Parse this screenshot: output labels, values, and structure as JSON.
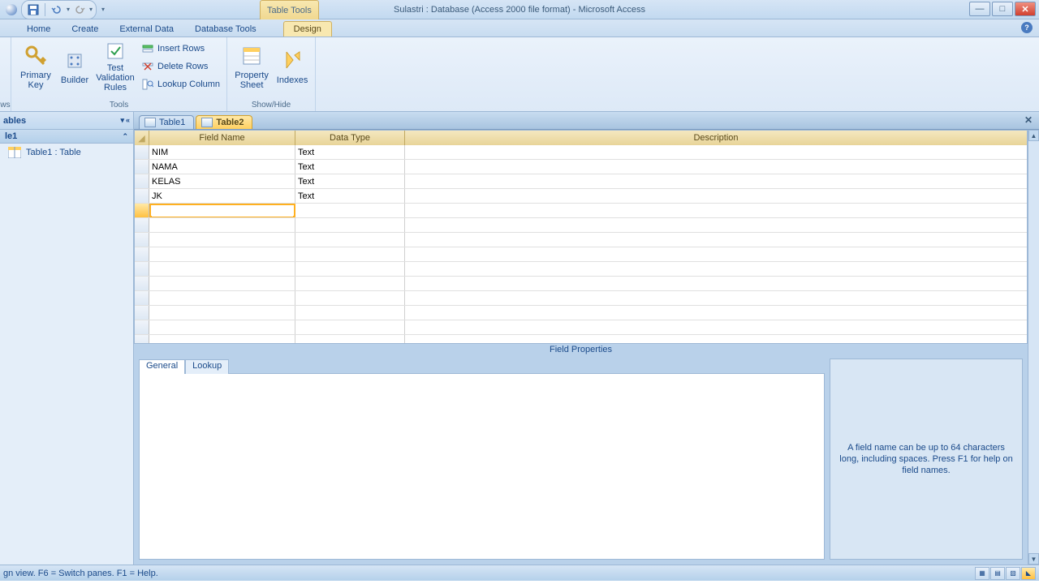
{
  "titlebar": {
    "context_tab": "Table Tools",
    "title": "Sulastri : Database (Access 2000 file format) - Microsoft Access"
  },
  "ribbon_tabs": {
    "home": "Home",
    "create": "Create",
    "external": "External Data",
    "dbtools": "Database Tools",
    "design": "Design"
  },
  "ribbon": {
    "views": "ws",
    "primary_key": "Primary Key",
    "builder": "Builder",
    "test_rules": "Test Validation Rules",
    "tools_label": "Tools",
    "insert_rows": "Insert Rows",
    "delete_rows": "Delete Rows",
    "lookup_column": "Lookup Column",
    "property_sheet": "Property Sheet",
    "indexes": "Indexes",
    "showhide_label": "Show/Hide"
  },
  "navpane": {
    "header": "ables",
    "group": "le1",
    "item1": "Table1 : Table"
  },
  "tabs": {
    "t1": "Table1",
    "t2": "Table2"
  },
  "grid": {
    "col_field": "Field Name",
    "col_type": "Data Type",
    "col_desc": "Description",
    "rows": [
      {
        "name": "NIM",
        "type": "Text"
      },
      {
        "name": "NAMA",
        "type": "Text"
      },
      {
        "name": "KELAS",
        "type": "Text"
      },
      {
        "name": "JK",
        "type": "Text"
      }
    ],
    "current_value": ""
  },
  "field_props": {
    "label": "Field Properties",
    "tab_general": "General",
    "tab_lookup": "Lookup",
    "help": "A field name can be up to 64 characters long, including spaces.  Press F1 for help on field names."
  },
  "status": {
    "text": "gn view.  F6 = Switch panes.  F1 = Help."
  }
}
